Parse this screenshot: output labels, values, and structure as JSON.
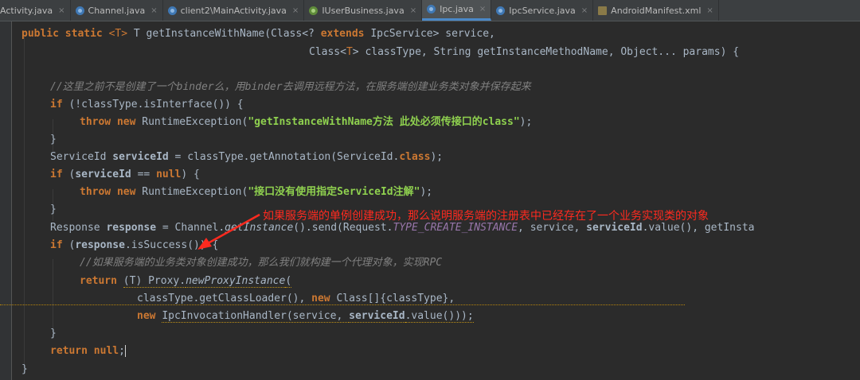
{
  "tabs": [
    {
      "label": "Activity.java",
      "icon": "class-icon",
      "active": false
    },
    {
      "label": "Channel.java",
      "icon": "class-icon",
      "active": false
    },
    {
      "label": "client2\\MainActivity.java",
      "icon": "class-icon",
      "active": false
    },
    {
      "label": "IUserBusiness.java",
      "icon": "interface-icon",
      "active": false
    },
    {
      "label": "Ipc.java",
      "icon": "class-icon",
      "active": true
    },
    {
      "label": "IpcService.java",
      "icon": "class-icon",
      "active": false
    },
    {
      "label": "AndroidManifest.xml",
      "icon": "xml-icon",
      "active": false
    }
  ],
  "tab_close_glyph": "×",
  "annotation": "如果服务端的单例创建成功，那么说明服务端的注册表中已经存在了一个业务实现类的对象",
  "code": {
    "l1": {
      "a": "public static ",
      "b": "<T> ",
      "c": "T getInstanceWithName(Class<? ",
      "d": "extends ",
      "e": "IpcService> service,"
    },
    "l2": {
      "a": "Class<",
      "b": "T",
      "c": "> classType, String getInstanceMethodName, Object... params) {"
    },
    "l3": {
      "a": "//这里之前不是创建了一个binder么，用binder去调用远程方法，在服务端创建业务类对象并保存起来"
    },
    "l4": {
      "a": "if ",
      "b": "(!classType.isInterface()) {"
    },
    "l5": {
      "a": "throw new ",
      "b": "RuntimeException(",
      "c": "\"getInstanceWithName方法 此处必须传接口的class\"",
      "d": ");"
    },
    "l6": {
      "a": "}"
    },
    "l7": {
      "a": "ServiceId ",
      "b": "serviceId",
      "c": " = classType.getAnnotation(ServiceId.",
      "d": "class",
      "e": ");"
    },
    "l8": {
      "a": "if ",
      "b": "(",
      "c": "serviceId",
      "d": " == ",
      "e": "null",
      "f": ") {"
    },
    "l9": {
      "a": "throw new ",
      "b": "RuntimeException(",
      "c": "\"接口没有使用指定ServiceId注解\"",
      "d": ");"
    },
    "l10": {
      "a": "}"
    },
    "l11": {
      "a": "Response ",
      "b": "response",
      "c": " = Channel.",
      "d": "getInstance",
      "e": "().send(Request.",
      "f": "TYPE_CREATE_INSTANCE",
      "g": ", service, ",
      "h": "serviceId",
      "i": ".value(), getInsta"
    },
    "l12": {
      "a": "if ",
      "b": "(",
      "c": "response",
      "d": ".isSuccess()) {"
    },
    "l13": {
      "a": "//如果服务端的业务类对象创建成功，那么我们就构建一个代理对象，实现RPC"
    },
    "l14": {
      "a": "return ",
      "b": "(T) Proxy.",
      "c": "newProxyInstance",
      "d": "("
    },
    "l15": {
      "a": "classType.getClassLoader(), ",
      "b": "new ",
      "c": "Class[]{classType},"
    },
    "l16": {
      "a": "new ",
      "b": "IpcInvocationHandler(service, ",
      "c": "serviceId",
      "d": ".value()));"
    },
    "l17": {
      "a": "}"
    },
    "l18": {
      "a": "return null",
      "b": ";"
    },
    "l19": {
      "a": "}"
    }
  }
}
